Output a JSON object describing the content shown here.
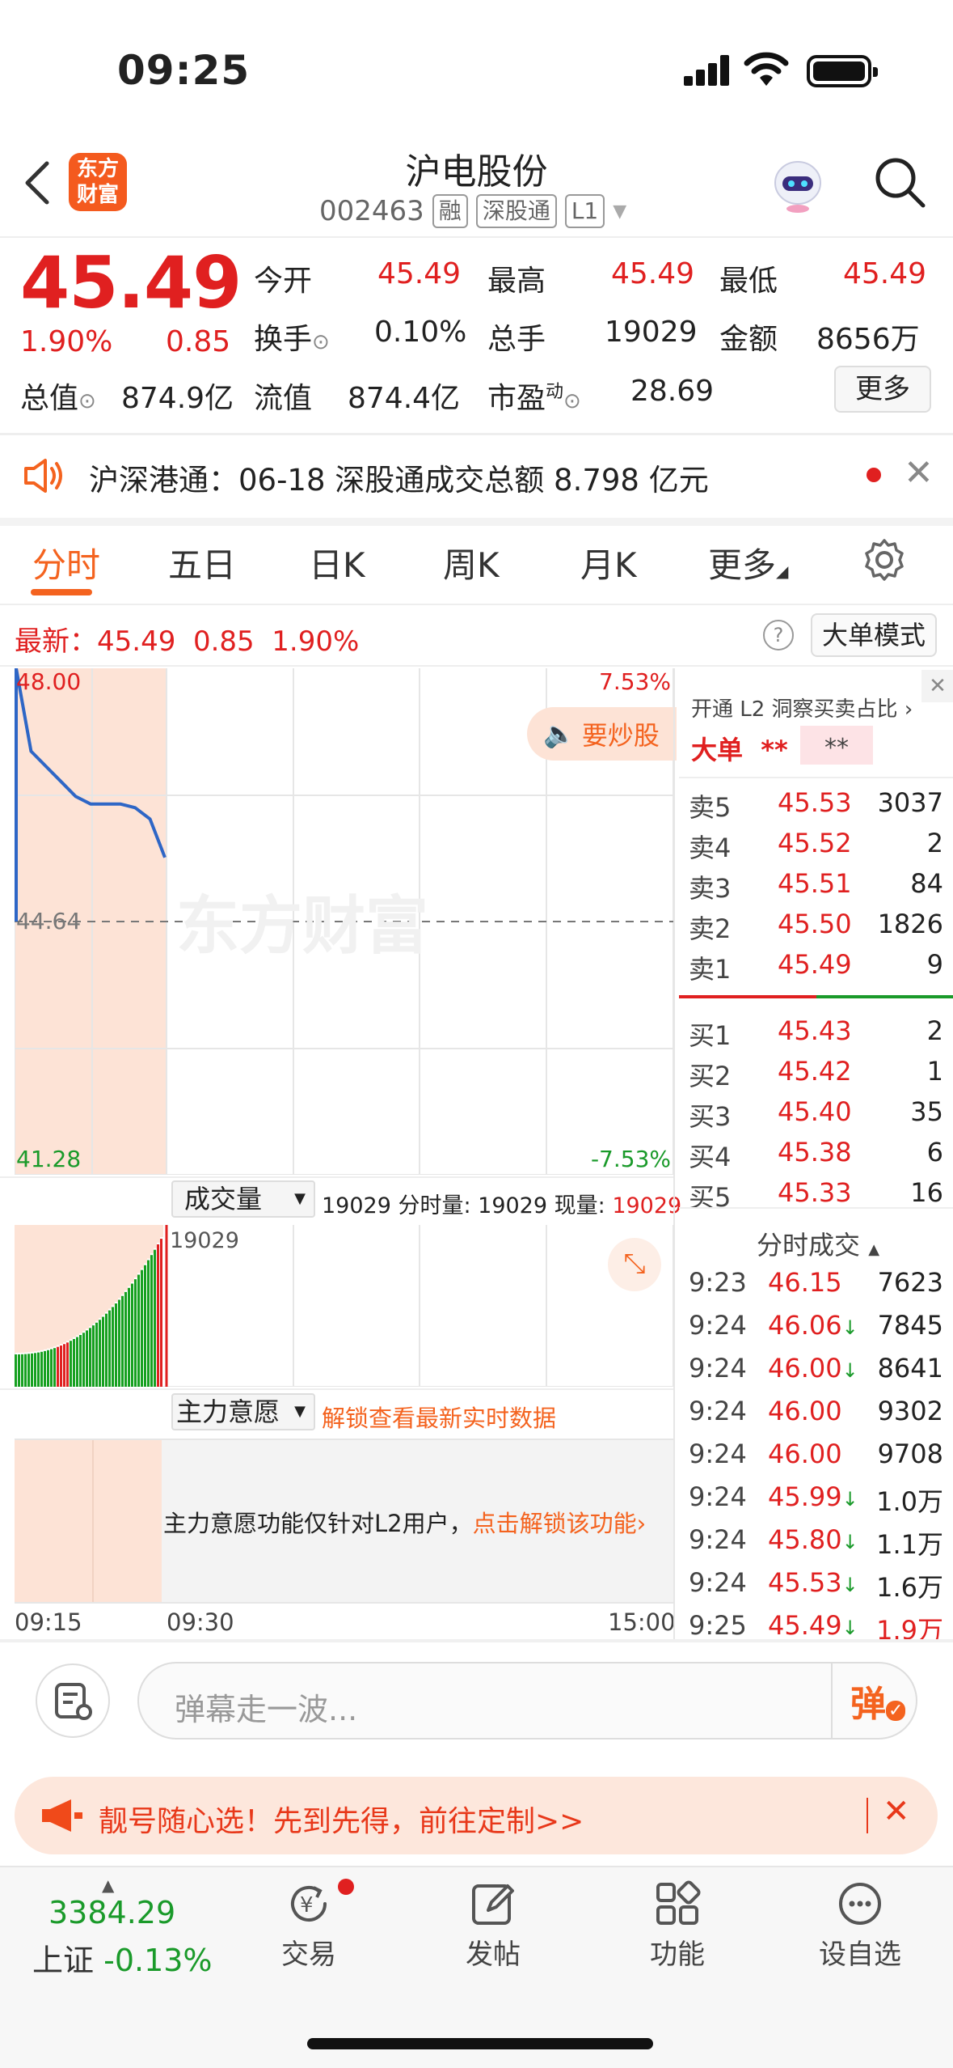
{
  "status": {
    "time": "09:25"
  },
  "header": {
    "title": "沪电股份",
    "code": "002463",
    "tags": [
      "融",
      "深股通",
      "L1"
    ],
    "logo_text": "东方\n财富"
  },
  "quote": {
    "price": "45.49",
    "pct": "1.90%",
    "change": "0.85",
    "labels": {
      "open": "今开",
      "high": "最高",
      "low": "最低",
      "turnover": "换手",
      "total_hands": "总手",
      "amount": "金额",
      "mkt_cap": "总值",
      "float_cap": "流值",
      "pe": "市盈"
    },
    "pe_sup": "动",
    "open": "45.49",
    "high": "45.49",
    "low": "45.49",
    "turnover": "0.10%",
    "total_hands": "19029",
    "amount": "8656万",
    "mkt_cap": "874.9亿",
    "float_cap": "874.4亿",
    "pe": "28.69",
    "more": "更多"
  },
  "notice": {
    "text": "沪深港通：06-18 深股通成交总额 8.798 亿元"
  },
  "tabs": [
    "分时",
    "五日",
    "日K",
    "周K",
    "月K",
    "更多"
  ],
  "latest_bar": {
    "label": "最新：",
    "price": "45.49",
    "change": "0.85",
    "pct": "1.90%",
    "mode": "大单模式"
  },
  "chart": {
    "y_top": "48.00",
    "y_mid": "44.64",
    "y_bot": "41.28",
    "pct_top": "7.53%",
    "pct_bot": "-7.53%",
    "watermark": "东方财富",
    "speak_btn": "要炒股",
    "vol_select": "成交量",
    "vol_info_prefix": "19029 分时量: 19029 现量: ",
    "vol_info_now": "19029",
    "vol_axis": "19029",
    "main_select": "主力意愿",
    "unlock_text": "解锁查看最新实时数据",
    "l2_text": "主力意愿功能仅针对L2用户，",
    "l2_link": "点击解锁该功能",
    "x_start": "09:15",
    "x_mid": "09:30",
    "x_end": "15:00"
  },
  "chart_data": {
    "type": "line",
    "x": [
      "09:15",
      "09:16",
      "09:17",
      "09:18",
      "09:19",
      "09:20",
      "09:21",
      "09:22",
      "09:23",
      "09:24",
      "09:25"
    ],
    "series": [
      {
        "values": [
          48.0,
          46.9,
          46.7,
          46.5,
          46.3,
          46.2,
          46.2,
          46.2,
          46.15,
          46.0,
          45.49
        ]
      }
    ],
    "ylim": [
      41.28,
      48.0
    ]
  },
  "orderbook": {
    "l2_banner": "开通 L2 洞察买卖占比",
    "bigorder": "大单",
    "stars1": "**",
    "stars2": "**",
    "asks": [
      {
        "label": "卖5",
        "price": "45.53",
        "vol": "3037"
      },
      {
        "label": "卖4",
        "price": "45.52",
        "vol": "2"
      },
      {
        "label": "卖3",
        "price": "45.51",
        "vol": "84"
      },
      {
        "label": "卖2",
        "price": "45.50",
        "vol": "1826"
      },
      {
        "label": "卖1",
        "price": "45.49",
        "vol": "9"
      }
    ],
    "bids": [
      {
        "label": "买1",
        "price": "45.43",
        "vol": "2"
      },
      {
        "label": "买2",
        "price": "45.42",
        "vol": "1"
      },
      {
        "label": "买3",
        "price": "45.40",
        "vol": "35"
      },
      {
        "label": "买4",
        "price": "45.38",
        "vol": "6"
      },
      {
        "label": "买5",
        "price": "45.33",
        "vol": "16"
      }
    ],
    "ticks_title": "分时成交",
    "ticks": [
      {
        "t": "9:23",
        "p": "46.15",
        "arrow": "",
        "v": "7623"
      },
      {
        "t": "9:24",
        "p": "46.06",
        "arrow": "↓",
        "v": "7845"
      },
      {
        "t": "9:24",
        "p": "46.00",
        "arrow": "↓",
        "v": "8641"
      },
      {
        "t": "9:24",
        "p": "46.00",
        "arrow": "",
        "v": "9302"
      },
      {
        "t": "9:24",
        "p": "46.00",
        "arrow": "",
        "v": "9708"
      },
      {
        "t": "9:24",
        "p": "45.99",
        "arrow": "↓",
        "v": "1.0万"
      },
      {
        "t": "9:24",
        "p": "45.80",
        "arrow": "↓",
        "v": "1.1万"
      },
      {
        "t": "9:24",
        "p": "45.53",
        "arrow": "↓",
        "v": "1.6万"
      },
      {
        "t": "9:25",
        "p": "45.49",
        "arrow": "↓",
        "v": "1.9万"
      }
    ]
  },
  "comment": {
    "placeholder": "弹幕走一波...",
    "btn": "弹"
  },
  "promo": {
    "text": "靓号随心选！先到先得，前往定制>>"
  },
  "bottom": {
    "index_value": "3384.29",
    "index_name": "上证",
    "index_pct": "-0.13%",
    "items": [
      "交易",
      "发帖",
      "功能",
      "设自选"
    ]
  }
}
